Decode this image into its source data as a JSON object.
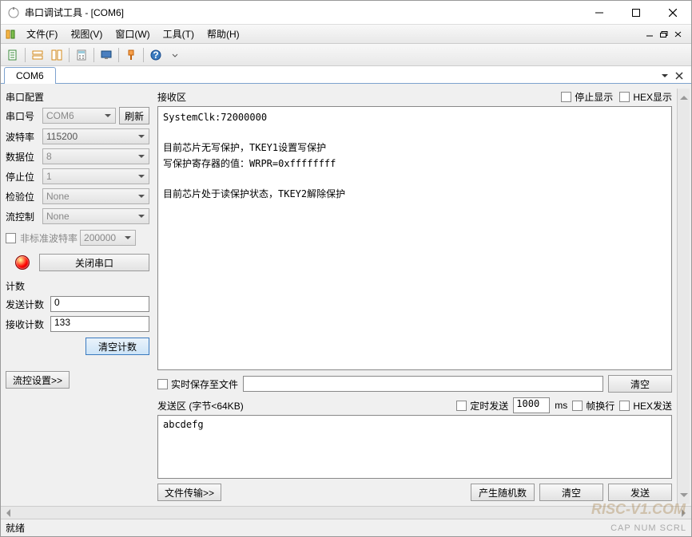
{
  "window": {
    "title": "串口调试工具 - [COM6]"
  },
  "menubar": {
    "file": "文件(F)",
    "view": "视图(V)",
    "window": "窗口(W)",
    "tools": "工具(T)",
    "help": "帮助(H)"
  },
  "tab": {
    "label": "COM6"
  },
  "serial_cfg": {
    "title": "串口配置",
    "port_label": "串口号",
    "port_value": "COM6",
    "refresh": "刷新",
    "baud_label": "波特率",
    "baud_value": "115200",
    "data_label": "数据位",
    "data_value": "8",
    "stop_label": "停止位",
    "stop_value": "1",
    "parity_label": "检验位",
    "parity_value": "None",
    "flow_label": "流控制",
    "flow_value": "None",
    "nonstd_label": "非标准波特率",
    "nonstd_value": "200000",
    "close_btn": "关闭串口"
  },
  "counter": {
    "title": "计数",
    "send_label": "发送计数",
    "send_value": "0",
    "recv_label": "接收计数",
    "recv_value": "133",
    "clear_btn": "清空计数"
  },
  "flow_btn": "流控设置>>",
  "recv": {
    "title": "接收区",
    "stop_disp": "停止显示",
    "hex_disp": "HEX显示",
    "content": "SystemClk:72000000\n\n目前芯片无写保护，TKEY1设置写保护\n写保护寄存器的值：WRPR=0xffffffff\n\n目前芯片处于读保护状态，TKEY2解除保护"
  },
  "save_file": {
    "label": "实时保存至文件",
    "clear_btn": "清空"
  },
  "send": {
    "title": "发送区 (字节<64KB)",
    "timed_label": "定时发送",
    "interval": "1000",
    "ms": "ms",
    "wrap_label": "帧换行",
    "hex_label": "HEX发送",
    "content": "abcdefg",
    "file_btn": "文件传输>>",
    "rand_btn": "产生随机数",
    "clear_btn": "清空",
    "send_btn": "发送"
  },
  "status": {
    "text": "就绪",
    "caps": "CAP  NUM  SCRL"
  },
  "watermark": "RISC-V1.COM"
}
